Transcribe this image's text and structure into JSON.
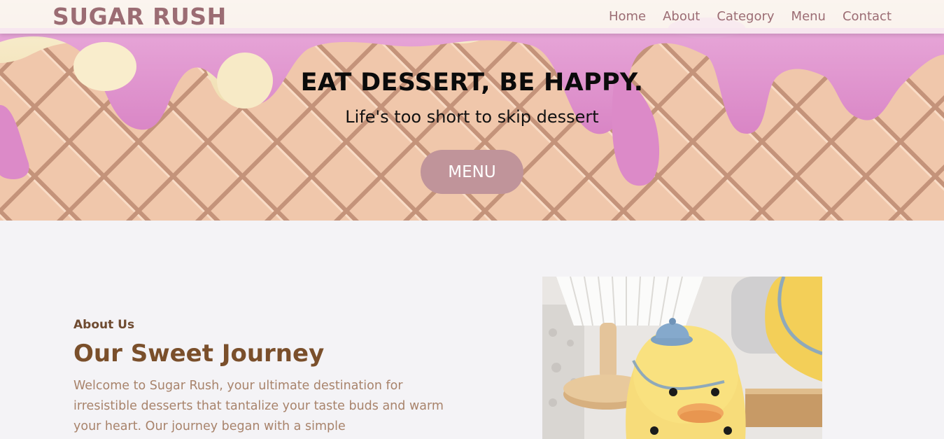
{
  "nav": {
    "brand": "SUGAR RUSH",
    "links": [
      "Home",
      "About",
      "Category",
      "Menu",
      "Contact"
    ]
  },
  "hero": {
    "title": "EAT DESSERT, BE HAPPY.",
    "subtitle": "Life's too short to skip dessert",
    "button_label": "MENU"
  },
  "about": {
    "eyebrow": "About Us",
    "title": "Our Sweet Journey",
    "text": "Welcome to Sugar Rush, your ultimate destination for irresistible desserts that tantalize your taste buds and warm your heart. Our journey began with a simple"
  },
  "colors": {
    "brand": "#9b6c73",
    "button": "#c0949a",
    "heading_brown": "#7a4f2b",
    "body_brown": "#a8836b",
    "page_bg": "#f4f3f6"
  }
}
